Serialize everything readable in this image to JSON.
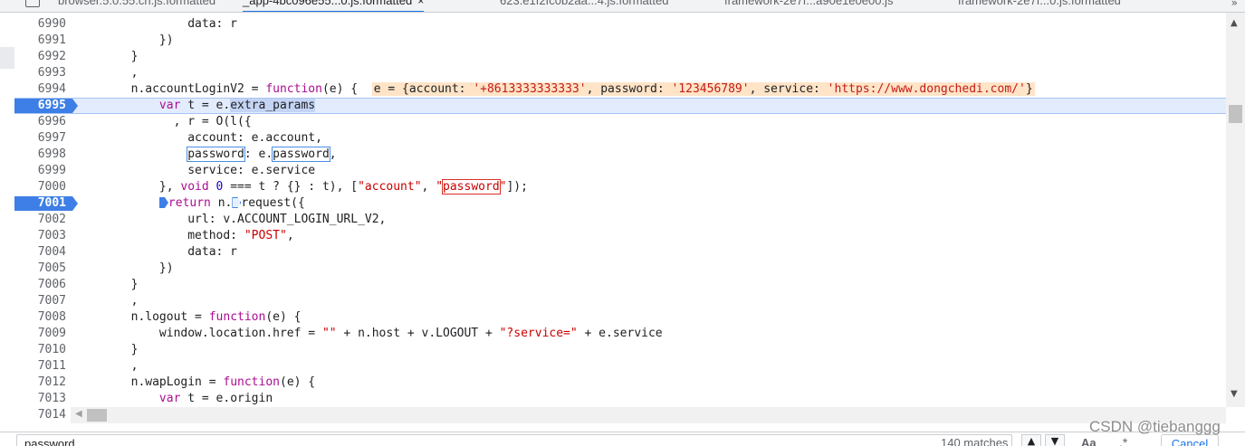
{
  "tabs": [
    {
      "label": "browser.5.0.55.cn.js:formatted",
      "active": false
    },
    {
      "label": "_app-4bc096e55...0.js:formatted",
      "active": true
    },
    {
      "label": "623.e1f2fc0b2aa...4.js:formatted",
      "active": false
    },
    {
      "label": "framework-2e7f...a90e1e0e00.js",
      "active": false
    },
    {
      "label": "framework-2e7f...0.js:formatted",
      "active": false
    }
  ],
  "tab_close_glyph": "×",
  "tab_more_glyph": "»",
  "code": {
    "lines": [
      {
        "n": "6990",
        "text": "                data: r"
      },
      {
        "n": "6991",
        "text": "            })"
      },
      {
        "n": "6992",
        "text": "        }"
      },
      {
        "n": "6993",
        "text": "        ,"
      },
      {
        "n": "6994",
        "text": ""
      },
      {
        "n": "6995",
        "text": ""
      },
      {
        "n": "6996",
        "text": "              , r = O(l({"
      },
      {
        "n": "6997",
        "text": "                account: e.account,"
      },
      {
        "n": "6998",
        "text": ""
      },
      {
        "n": "6999",
        "text": "                service: e.service"
      },
      {
        "n": "7000",
        "text": ""
      },
      {
        "n": "7001",
        "text": ""
      },
      {
        "n": "7002",
        "text": "                url: v.ACCOUNT_LOGIN_URL_V2,"
      },
      {
        "n": "7003",
        "text": ""
      },
      {
        "n": "7004",
        "text": "                data: r"
      },
      {
        "n": "7005",
        "text": "            })"
      },
      {
        "n": "7006",
        "text": "        }"
      },
      {
        "n": "7007",
        "text": "        ,"
      },
      {
        "n": "7008",
        "text": ""
      },
      {
        "n": "7009",
        "text": ""
      },
      {
        "n": "7010",
        "text": "        }"
      },
      {
        "n": "7011",
        "text": "        ,"
      },
      {
        "n": "7012",
        "text": ""
      },
      {
        "n": "7013",
        "text": ""
      },
      {
        "n": "7014",
        "text": ""
      }
    ],
    "line6994": {
      "prefix": "        n.accountLoginV2 = ",
      "kw": "function",
      "args": "(e) {",
      "inline": "e = {account: ",
      "account_val": "'+8613333333333'",
      "mid1": ", password: ",
      "password_val": "'123456789'",
      "mid2": ", service: ",
      "service_val": "'https://www.dongchedi.com/'",
      "end": "}"
    },
    "line6995": {
      "indent": "            ",
      "kw": "var",
      "mid": " t = e.",
      "sel": "extra_params"
    },
    "line6998": {
      "indent": "                ",
      "a": "password",
      "b": ": e.",
      "c": "password",
      "d": ","
    },
    "line7000": {
      "a": "            }, ",
      "kw": "void",
      "b": " ",
      "num": "0",
      "c": " === t ? {} : t), [",
      "s1": "\"account\"",
      "d": ", ",
      "q1": "\"",
      "s2": "password",
      "q2": "\"",
      "e": "]);"
    },
    "line7001": {
      "indent": "            ",
      "kw": "return",
      "a": " n.",
      "b": "request({"
    },
    "line7003": {
      "a": "                method: ",
      "s": "\"POST\"",
      "b": ","
    },
    "line7008": {
      "a": "        n.logout = ",
      "kw": "function",
      "b": "(e) {"
    },
    "line7009": {
      "a": "            window.location.href = ",
      "s1": "\"\"",
      "b": " + n.host + v.LOGOUT + ",
      "s2": "\"?service=\"",
      "c": " + e.service"
    },
    "line7012": {
      "a": "        n.wapLogin = ",
      "kw": "function",
      "b": "(e) {"
    },
    "line7013": {
      "indent": "            ",
      "kw": "var",
      "a": " t = e.origin"
    }
  },
  "breakpoints": [
    "6995",
    "7001"
  ],
  "search": {
    "value": "password",
    "match_count": "140 matches",
    "up_glyph": "▲",
    "down_glyph": "▼",
    "case_label": "Aa",
    "regex_label": ".*",
    "cancel_label": "Cancel"
  },
  "watermark": "CSDN @tiebanggg",
  "scroll": {
    "up": "▲",
    "down": "▼",
    "left": "◀"
  }
}
